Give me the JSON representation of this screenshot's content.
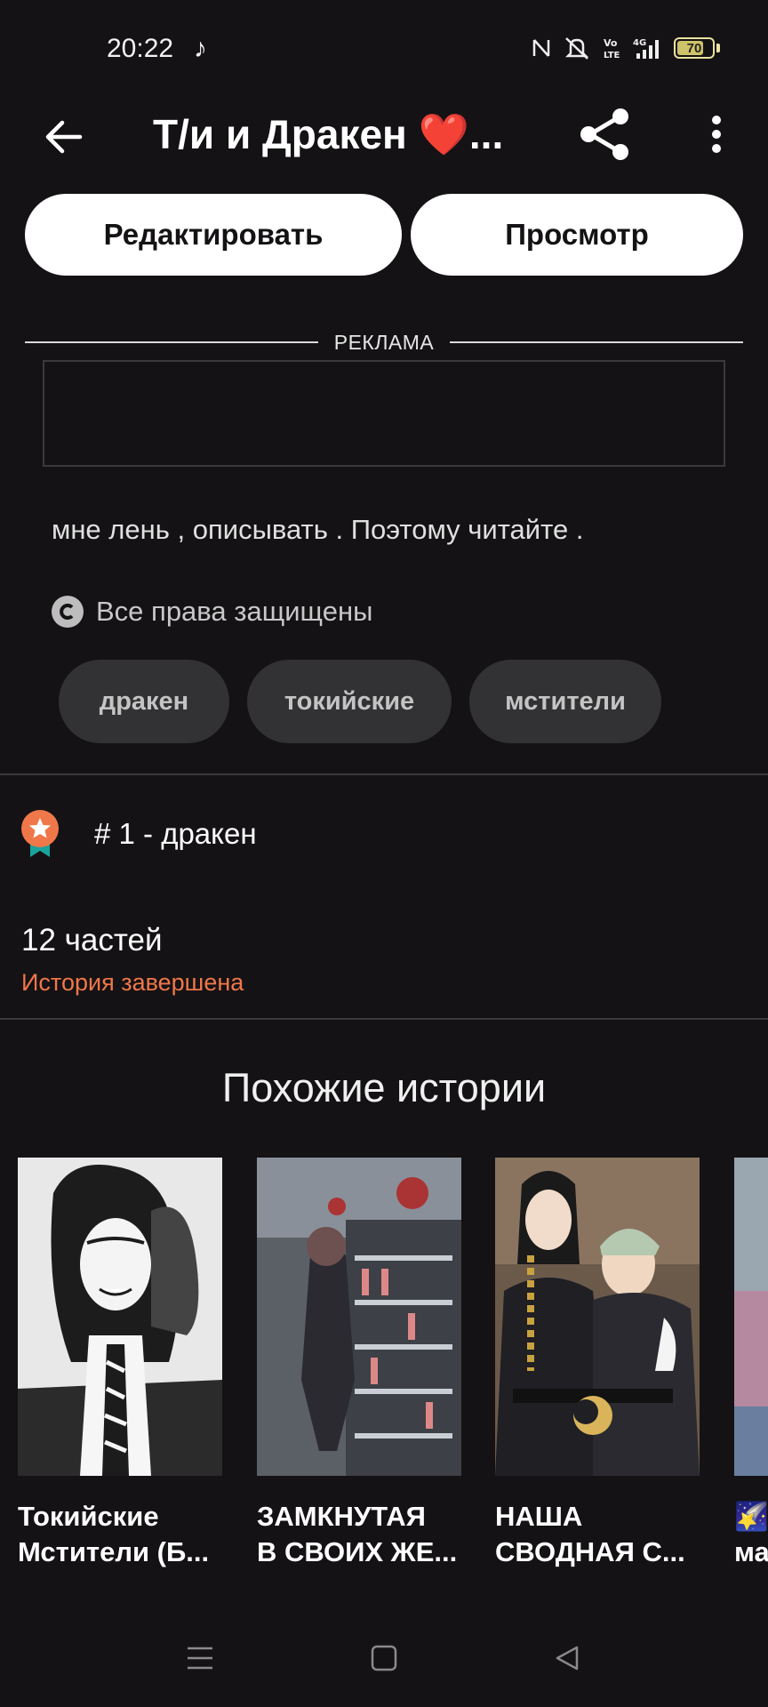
{
  "status_bar": {
    "time": "20:22",
    "music_glyph": "♪",
    "battery_level": 70,
    "battery_label": "70"
  },
  "app_bar": {
    "title": "Т/и и Дракен ❤️...",
    "back_icon": "arrow-left-icon",
    "share_icon": "share-icon",
    "more_icon": "more-vertical-icon"
  },
  "actions": {
    "edit_label": "Редактировать",
    "view_label": "Просмотр"
  },
  "ad": {
    "label": "РЕКЛАМА"
  },
  "story": {
    "description": "мне лень , описывать . Поэтому читайте .",
    "rights_icon": "copyright-icon",
    "rights": "Все права защищены",
    "tags": [
      {
        "label": "дракен"
      },
      {
        "label": "токийские"
      },
      {
        "label": "мстители"
      }
    ],
    "rank_icon": "ranking-badge-icon",
    "rank": "# 1 - дракен",
    "parts": "12 частей",
    "status": "История завершена"
  },
  "similar": {
    "title": "Похожие истории",
    "items": [
      {
        "title_line1": "Токийские",
        "title_line2": "Мстители (Б..."
      },
      {
        "title_line1": "ЗАМКНУТАЯ",
        "title_line2": "В СВОИХ ЖЕ..."
      },
      {
        "title_line1": "НАША",
        "title_line2": "СВОДНАЯ С..."
      },
      {
        "title_line1": "🌠💗",
        "title_line2": "ма"
      }
    ]
  },
  "colors": {
    "background": "#141214",
    "accent": "#f0774a",
    "tag_bg": "#323133"
  }
}
